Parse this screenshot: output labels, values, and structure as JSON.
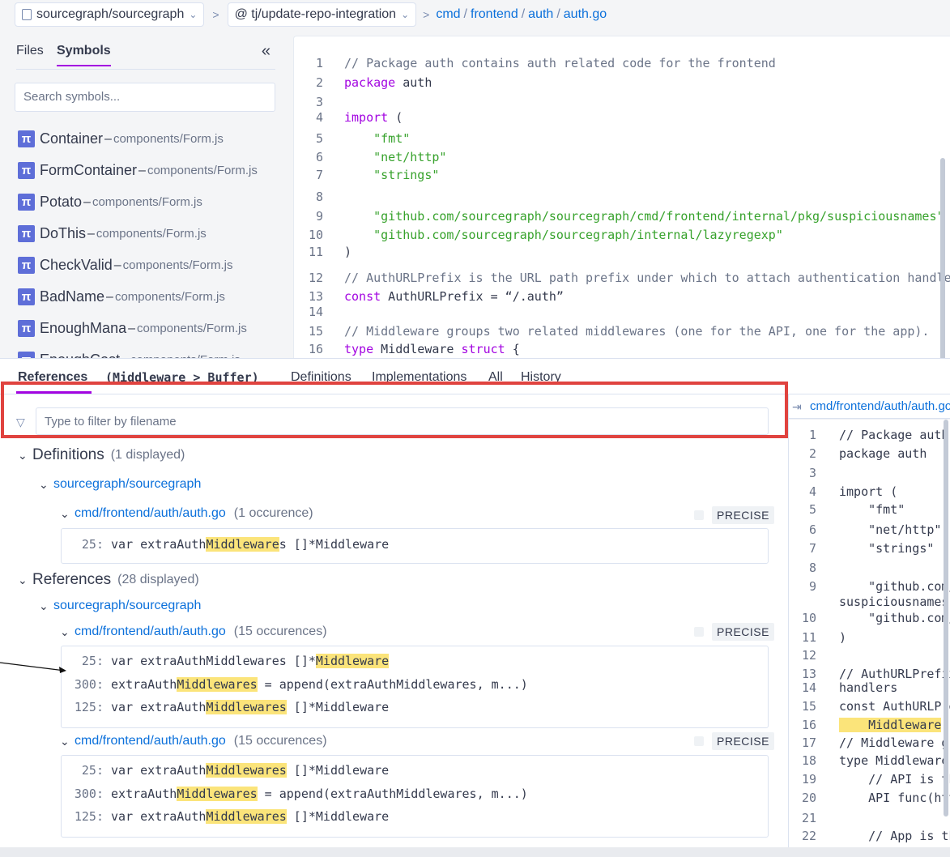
{
  "breadcrumb": {
    "repo": "sourcegraph/sourcegraph",
    "revision": "@ tj/update-repo-integration",
    "path": [
      "cmd",
      "frontend",
      "auth",
      "auth.go"
    ]
  },
  "sidebar": {
    "tabs": [
      "Files",
      "Symbols"
    ],
    "active_tab": "Symbols",
    "collapse_glyph": "«",
    "search_placeholder": "Search symbols...",
    "symbols": [
      {
        "name": "Container",
        "path": "components/Form.js"
      },
      {
        "name": "FormContainer",
        "path": "components/Form.js"
      },
      {
        "name": "Potato",
        "path": "components/Form.js"
      },
      {
        "name": "DoThis",
        "path": "components/Form.js"
      },
      {
        "name": "CheckValid",
        "path": "components/Form.js"
      },
      {
        "name": "BadName",
        "path": "components/Form.js"
      },
      {
        "name": "EnoughMana",
        "path": "components/Form.js"
      },
      {
        "name": "EnoughCost",
        "path": "components/Form.js"
      }
    ]
  },
  "code": {
    "lines": [
      {
        "n": "1",
        "parts": [
          [
            "cmt",
            "// Package auth contains auth related code for the frontend"
          ]
        ]
      },
      {
        "n": "2",
        "parts": [
          [
            "kw",
            "package"
          ],
          [
            "",
            " auth"
          ]
        ]
      },
      {
        "n": "3",
        "parts": []
      },
      {
        "n": "4",
        "parts": [
          [
            "kw",
            "import"
          ],
          [
            "",
            " ("
          ]
        ]
      },
      {
        "n": "5",
        "parts": [
          [
            "",
            "    "
          ],
          [
            "str",
            "\"fmt\""
          ]
        ]
      },
      {
        "n": "6",
        "parts": [
          [
            "",
            "    "
          ],
          [
            "str",
            "\"net/http\""
          ]
        ]
      },
      {
        "n": "7",
        "parts": [
          [
            "",
            "    "
          ],
          [
            "str",
            "\"strings\""
          ]
        ]
      },
      {
        "n": "8",
        "parts": []
      },
      {
        "n": "9",
        "parts": [
          [
            "",
            "    "
          ],
          [
            "str",
            "\"github.com/sourcegraph/sourcegraph/cmd/frontend/internal/pkg/suspiciousnames\""
          ]
        ]
      },
      {
        "n": "10",
        "parts": [
          [
            "",
            "    "
          ],
          [
            "str",
            "\"github.com/sourcegraph/sourcegraph/internal/lazyregexp\""
          ]
        ]
      },
      {
        "n": "11",
        "parts": [
          [
            "",
            ")"
          ]
        ]
      },
      {
        "n": "12",
        "parts": [
          [
            "cmt",
            "// AuthURLPrefix is the URL path prefix under which to attach authentication handlers"
          ]
        ]
      },
      {
        "n": "13",
        "parts": [
          [
            "kw",
            "const"
          ],
          [
            "",
            " AuthURLPrefix = “/.auth”"
          ]
        ]
      },
      {
        "n": "14",
        "parts": []
      },
      {
        "n": "15",
        "parts": [
          [
            "cmt",
            "// Middleware groups two related middlewares (one for the API, one for the app)."
          ]
        ]
      },
      {
        "n": "16",
        "parts": [
          [
            "kw",
            "type"
          ],
          [
            "",
            " Middleware "
          ],
          [
            "kw",
            "struct"
          ],
          [
            "",
            " {"
          ]
        ]
      }
    ]
  },
  "panel": {
    "tabs": [
      "References",
      "(Middleware > Buffer)",
      "Definitions",
      "Implementations",
      "All",
      "History"
    ],
    "filter_placeholder": "Type to filter by filename",
    "definitions": {
      "title": "Definitions",
      "count": "(1 displayed)",
      "repo": "sourcegraph/sourcegraph",
      "file": "cmd/frontend/auth/auth.go",
      "occurrences": "(1 occurence)",
      "badge": "PRECISE",
      "lines": [
        {
          "n": "25:",
          "pre": " var extraAuth",
          "hl": "Middleware",
          "post": "s []*Middleware"
        }
      ]
    },
    "references": {
      "title": "References",
      "count": "(28 displayed)",
      "repo": "sourcegraph/sourcegraph",
      "files": [
        {
          "file": "cmd/frontend/auth/auth.go",
          "occurrences": "(15 occurences)",
          "badge": "PRECISE",
          "lines": [
            {
              "n": "25:",
              "pre": " var extraAuthMiddlewares []*",
              "hl": "Middleware",
              "post": ""
            },
            {
              "n": "300:",
              "pre": " extraAuth",
              "hl": "Middlewares",
              "post": " = append(extraAuthMiddlewares, m...)"
            },
            {
              "n": "125:",
              "pre": " var extraAuth",
              "hl": "Middlewares",
              "post": " []*Middleware"
            }
          ]
        },
        {
          "file": "cmd/frontend/auth/auth.go",
          "occurrences": "(15 occurences)",
          "badge": "PRECISE",
          "lines": [
            {
              "n": "25:",
              "pre": " var extraAuth",
              "hl": "Middlewares",
              "post": " []*Middleware"
            },
            {
              "n": "300:",
              "pre": " extraAuth",
              "hl": "Middlewares",
              "post": " = append(extraAuthMiddlewares, m...)"
            },
            {
              "n": "125:",
              "pre": " var extraAuth",
              "hl": "Middlewares",
              "post": " []*Middleware"
            }
          ]
        }
      ]
    }
  },
  "preview": {
    "path": "cmd/frontend/auth/auth.go",
    "lines": [
      {
        "n": "1",
        "cls": "cmt",
        "text": "// Package auth contains auth related code"
      },
      {
        "n": "2",
        "cls": "",
        "text": "package auth"
      },
      {
        "n": "3",
        "cls": "",
        "text": ""
      },
      {
        "n": "4",
        "cls": "",
        "text": "import ("
      },
      {
        "n": "5",
        "cls": "str",
        "text": "    \"fmt\""
      },
      {
        "n": "6",
        "cls": "str",
        "text": "    \"net/http\""
      },
      {
        "n": "7",
        "cls": "str",
        "text": "    \"strings\""
      },
      {
        "n": "8",
        "cls": "",
        "text": ""
      },
      {
        "n": "9",
        "cls": "str",
        "text": "    \"github.com/sourcegraph/sourcegraph/cmd/frontend/internal/pkg/"
      },
      {
        "n": "",
        "cls": "str",
        "text": "suspiciousnames\""
      },
      {
        "n": "10",
        "cls": "str",
        "text": "    \"github.com/sourcegraph/sourcegraph/internal/lazyregexp\""
      },
      {
        "n": "11",
        "cls": "",
        "text": ")"
      },
      {
        "n": "12",
        "cls": "",
        "text": ""
      },
      {
        "n": "13",
        "cls": "cmt",
        "text": "// AuthURLPrefix is the URL path prefix under which to attach authentication"
      },
      {
        "n": "14",
        "cls": "cmt",
        "text": "handlers"
      },
      {
        "n": "15",
        "cls": "",
        "text": "const AuthURLPrefix = “/.auth”"
      },
      {
        "n": "16",
        "cls": "hl",
        "text": "    Middleware"
      },
      {
        "n": "17",
        "cls": "cmt",
        "text": "// Middleware groups two related middlewares"
      },
      {
        "n": "18",
        "cls": "",
        "text": "type Middleware struct {"
      },
      {
        "n": "19",
        "cls": "cmt",
        "text": "    // API is the middleware for the API"
      },
      {
        "n": "20",
        "cls": "",
        "text": "    API func(http.Handler) http.Handler"
      },
      {
        "n": "21",
        "cls": "",
        "text": ""
      },
      {
        "n": "22",
        "cls": "cmt",
        "text": "    // App is the middleware for the app"
      }
    ]
  }
}
